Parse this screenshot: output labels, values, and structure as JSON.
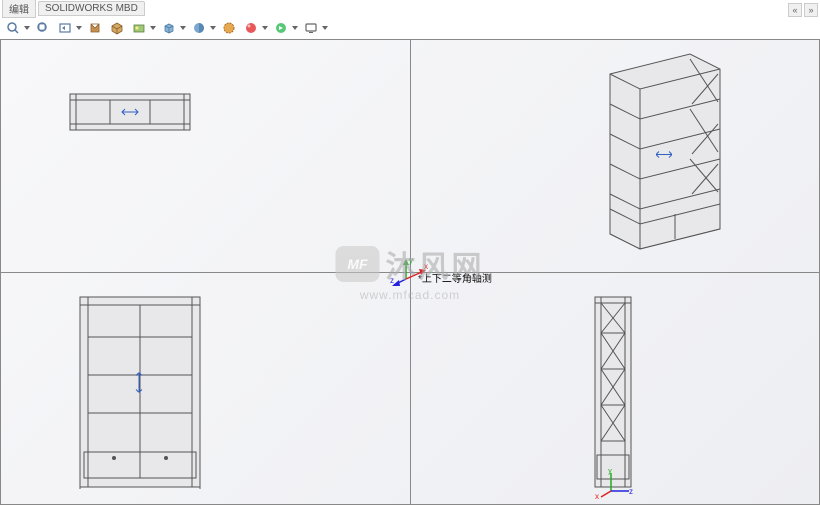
{
  "tabs": [
    {
      "label": "编辑"
    },
    {
      "label": "SOLIDWORKS MBD"
    }
  ],
  "toolbar": {
    "zoom_window": "zoom-window",
    "zoom_fit": "zoom-fit",
    "prev_view": "prev-view",
    "section": "section-view",
    "display_style": "display-style",
    "scene": "scene",
    "cube": "view-cube",
    "shaded": "shaded",
    "hidden": "hidden-lines",
    "appearance": "appearance",
    "render": "render",
    "screen": "screen"
  },
  "viewport": {
    "origin_label": "*上下二等角轴测",
    "axes": {
      "x": "x",
      "y": "y",
      "z": "z"
    }
  },
  "watermark": {
    "badge": "MF",
    "text": "沐风网",
    "url": "www.mfcad.com"
  },
  "nav": {
    "prev": "«",
    "next": "»"
  }
}
